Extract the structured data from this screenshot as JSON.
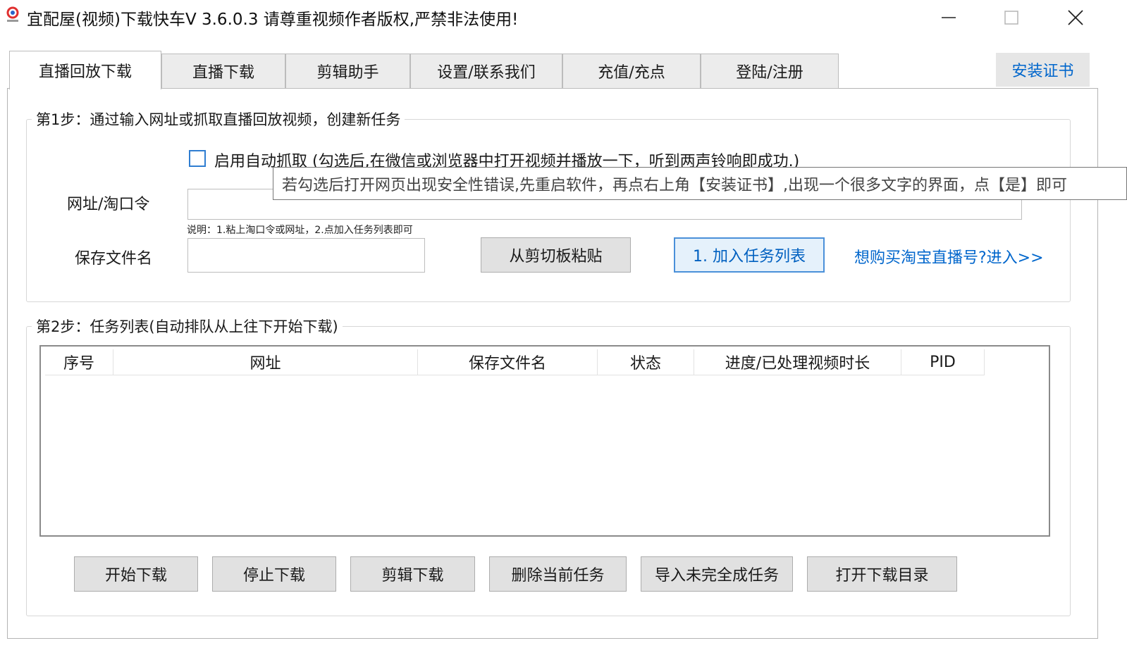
{
  "window": {
    "title": "宜配屋(视频)下载快车V 3.6.0.3 请尊重视频作者版权,严禁非法使用!",
    "icon": "app-logo-icon",
    "controls": [
      "minimize-icon",
      "maximize-icon",
      "close-icon"
    ]
  },
  "tabs": [
    {
      "label": "直播回放下载",
      "active": true
    },
    {
      "label": "直播下载",
      "active": false
    },
    {
      "label": "剪辑助手",
      "active": false
    },
    {
      "label": "设置/联系我们",
      "active": false
    },
    {
      "label": "充值/充点",
      "active": false
    },
    {
      "label": "登陆/注册",
      "active": false
    }
  ],
  "install_cert_label": "安装证书",
  "step1": {
    "title": "第1步：通过输入网址或抓取直播回放视频，创建新任务",
    "auto_capture_label": "启用自动抓取 (勾选后,在微信或浏览器中打开视频并播放一下，听到两声铃响即成功.)",
    "auto_capture_checked": false,
    "tooltip": "若勾选后打开网页出现安全性错误,先重启软件，再点右上角【安装证书】,出现一个很多文字的界面，点【是】即可",
    "url_label": "网址/淘口令",
    "url_value": "",
    "hint": "说明：1.粘上淘口令或网址，2.点加入任务列表即可",
    "filename_label": "保存文件名",
    "filename_value": "",
    "paste_button": "从剪切板粘贴",
    "add_button": "1. 加入任务列表",
    "buy_link": "想购买淘宝直播号?进入>>"
  },
  "step2": {
    "title": "第2步：任务列表(自动排队从上往下开始下载)",
    "columns": [
      "序号",
      "网址",
      "保存文件名",
      "状态",
      "进度/已处理视频时长",
      "PID"
    ],
    "rows": []
  },
  "actions": [
    "开始下载",
    "停止下载",
    "剪辑下载",
    "删除当前任务",
    "导入未完全成任务",
    "打开下载目录"
  ],
  "colors": {
    "accent": "#0066cc",
    "checkbox_border": "#2f7dd1",
    "button_bg": "#e1e1e1",
    "primary_border": "#4a90d9"
  }
}
